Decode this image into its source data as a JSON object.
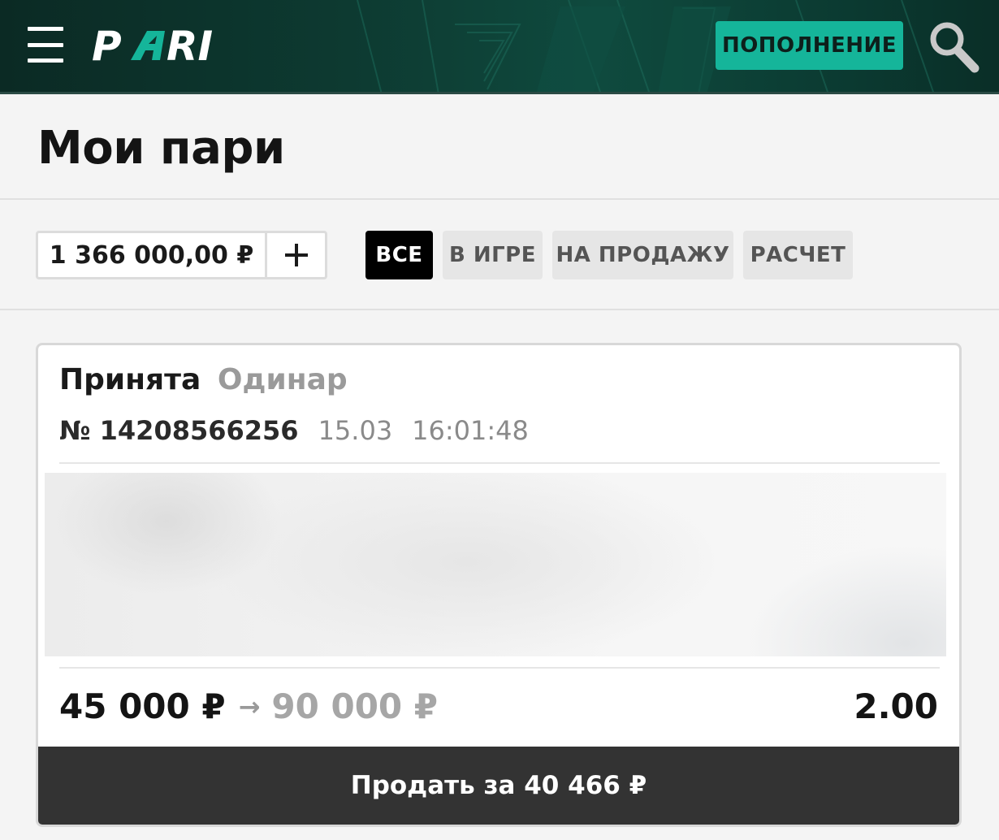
{
  "header": {
    "logo_text": "PARI",
    "deposit_label": "ПОПОЛНЕНИЕ",
    "menu_icon": "hamburger-menu-icon",
    "search_icon": "search-icon",
    "colors": {
      "background": "#0d3a31",
      "accent": "#15b59a"
    }
  },
  "page": {
    "title": "Мои пари"
  },
  "balance": {
    "value": "1 366 000,00 ₽",
    "add_icon": "plus-icon"
  },
  "filters": {
    "tabs": [
      {
        "label": "ВСЕ",
        "active": true
      },
      {
        "label": "В ИГРЕ",
        "active": false
      },
      {
        "label": "НА ПРОДАЖУ",
        "active": false
      },
      {
        "label": "РАСЧЕТ",
        "active": false
      }
    ]
  },
  "bet": {
    "status": "Принята",
    "type": "Одинар",
    "number": "№ 14208566256",
    "date": "15.03",
    "time": "16:01:48",
    "stake": "45 000 ₽",
    "arrow": "→",
    "payout": "90 000 ₽",
    "odds": "2.00",
    "sell_label": "Продать за 40 466 ₽"
  }
}
